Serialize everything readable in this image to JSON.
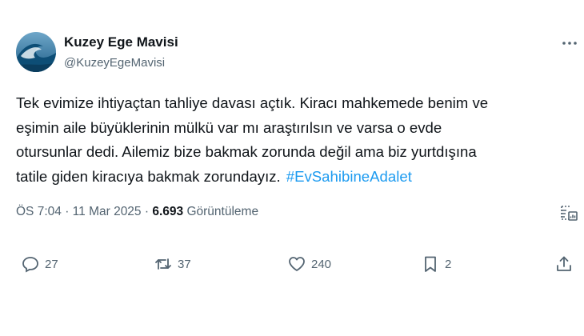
{
  "user": {
    "display_name": "Kuzey Ege Mavisi",
    "handle": "@KuzeyEgeMavisi"
  },
  "tweet": {
    "lines": [
      "Tek evimize ihtiyaçtan tahliye davası açtık. Kiracı mahkemede benim ve",
      "eşimin aile büyüklerinin mülkü var mı araştırılsın ve varsa o evde",
      "otursunlar dedi. Ailemiz bize bakmak zorunda değil ama biz yurtdışına",
      "tatile giden kiracıya bakmak zorundayız."
    ],
    "hashtag": "#EvSahibineAdalet"
  },
  "meta": {
    "time": "ÖS 7:04",
    "separator": "·",
    "date": "11 Mar 2025",
    "views_count": "6.693",
    "views_label": "Görüntüleme"
  },
  "actions": {
    "replies": "27",
    "reposts": "37",
    "likes": "240",
    "bookmarks": "2"
  },
  "icons": {
    "avatar": "wave-avatar",
    "more": "more-dots-icon",
    "analytics": "analytics-icon",
    "reply": "reply-icon",
    "repost": "repost-icon",
    "like": "heart-icon",
    "bookmark": "bookmark-icon",
    "share": "share-icon"
  },
  "colors": {
    "text": "#0f1419",
    "secondary": "#536471",
    "link": "#1d9bf0"
  }
}
